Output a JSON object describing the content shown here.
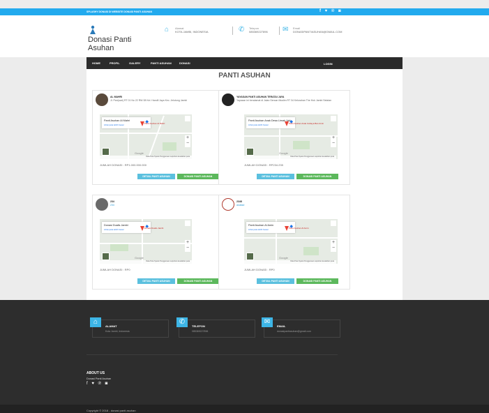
{
  "topbar": {
    "text": "SPLASHY DONASI DI WEBSITE DONASI PANTI ASUHAN",
    "social": "f ♥ ℗ ◙"
  },
  "header": {
    "brand": "Donasi Panti Asuhan",
    "alamat_label": "Alamat",
    "alamat_value": "KOTA JAMBI, INDONESIA",
    "telepon_label": "Telepon",
    "telepon_value": "085369227896",
    "email_label": "Email",
    "email_value": "DONASIPANTIASUHAN@GMAIL.COM"
  },
  "nav": {
    "items": [
      "HOME",
      "PROFIL",
      "GALERY",
      "PANTI ASUHAN",
      "DONASI"
    ],
    "login": "LOGIN"
  },
  "main": {
    "title": "PANTI ASUHAN"
  },
  "cards": [
    {
      "name": "AL MAHRI",
      "desc": "Jl. Parr(sari) RT 01 No 22 RW 08 Kel. Handil Jaya Kec. Jelutung Jambi",
      "map_title": "Panti Asuhan Al Mahri",
      "map_link": "Lihat peta lebih besar",
      "pin_label": "Panti Asuhan Al Mahri",
      "jumlah": "JUMLAH DONASI : RP1.000.000.000",
      "btn_detail": "DETAIL PANTI ASUHAN",
      "btn_donasi": "DONASI PANTI ASUHAN"
    },
    {
      "name": "YAYASAN PANTI ASUHAN TERATAI JAYA",
      "desc": "Yayasan ini beralamat di Jalan Sersan Muslim RT 34 Kelurahan The Hok Jambi Selatan",
      "map_title": "Panti Asuhan Anak Desa Limah Yati...",
      "map_link": "Lihat peta lebih besar",
      "pin_label": "Panti Asuhan Anak Cahaya Ban Amin",
      "jumlah": "JUMLAH DONASI : RP234.235",
      "btn_detail": "DETAIL PANTI ASUHAN",
      "btn_donasi": "DONASI PANTI ASUHAN"
    },
    {
      "name": "234",
      "desc": "234",
      "map_title": "Donasi Dualis Jambi",
      "map_link": "Lihat peta lebih besar",
      "pin_label": "Donasi Dualis Jambi",
      "jumlah": "JUMLAH DONASI : RP0",
      "btn_detail": "DETAIL PANTI ASUHAN",
      "btn_donasi": "DONASI PANTI ASUHAN"
    },
    {
      "name": "2348",
      "desc": "asdasd",
      "map_title": "Panti Asuhan Al Amin",
      "map_link": "Lihat peta lebih besar",
      "pin_label": "Panti Asuhan Al Amin",
      "jumlah": "JUMLAH DONASI : RP0",
      "btn_detail": "DETAIL PANTI ASUHAN",
      "btn_donasi": "DONASI PANTI ASUHAN"
    }
  ],
  "map_common": {
    "google": "Google",
    "legal": "Data Peta   Syarat Penggunaan   Laporkan kesalahan peta"
  },
  "footer": {
    "alamat_label": "ALAMAT",
    "alamat_value": "Kota Jambi, Indonesia",
    "telepon_label": "TELEPON",
    "telepon_value": "085369227896",
    "email_label": "EMAIL",
    "email_value": "donasipantiasuhan@gmail.com",
    "about_heading": "ABOUT US",
    "about_text": "Donasi Panti Asuhan",
    "about_social": "f ♥ ℗ ◙",
    "copyright": "Copyright © 2018 - donasi panti asuhan"
  },
  "colors": {
    "accent": "#22aaee",
    "detail_button": "#5bc0de",
    "donasi_button": "#5cb85c",
    "nav": "#2b2b2b",
    "footer": "#2d2d2d"
  }
}
